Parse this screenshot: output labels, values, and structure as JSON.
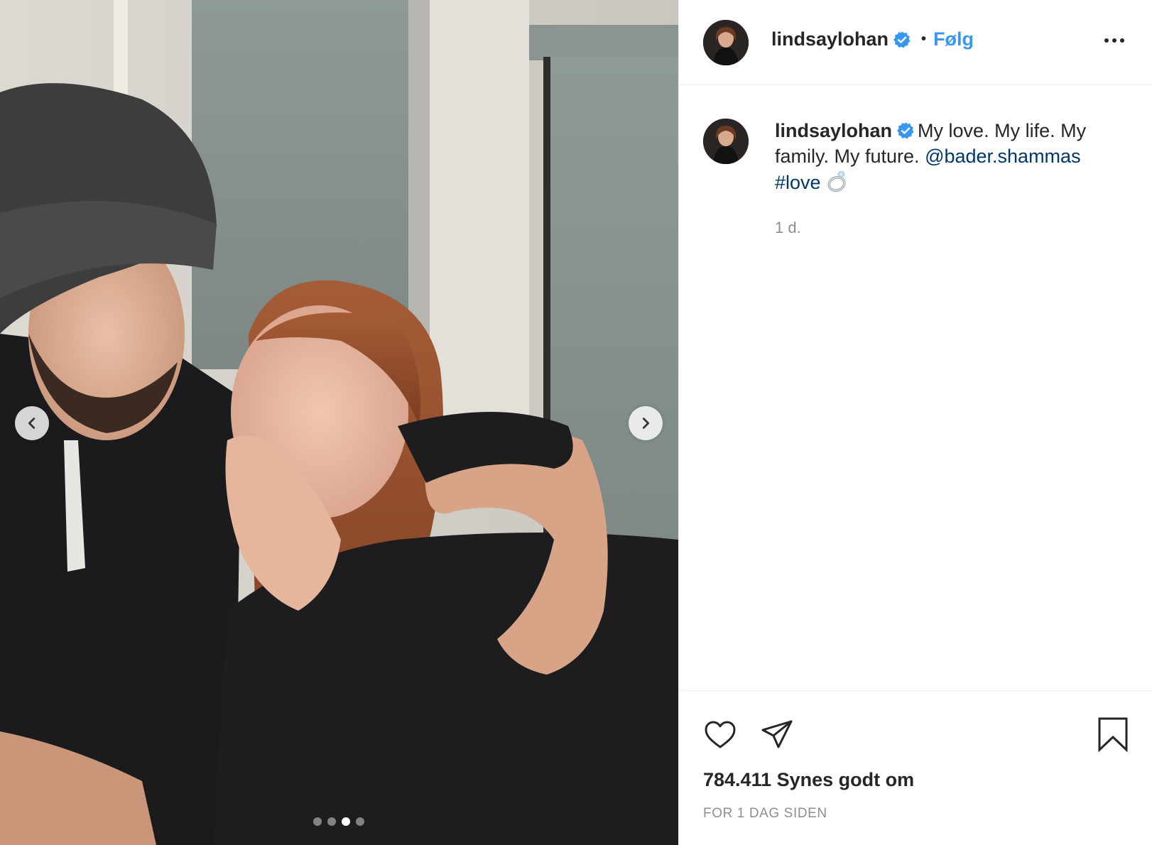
{
  "post": {
    "username": "lindsaylohan",
    "follow_label": "Følg",
    "separator": "•",
    "caption_text": "My love. My life. My family. My future.",
    "caption_mention": "@bader.shammas",
    "caption_hashtag": "#love",
    "comment_time": "1 d.",
    "likes": "784.411 Synes godt om",
    "posted_ago": "FOR 1 DAG SIDEN"
  },
  "carousel": {
    "total": 4,
    "active_index": 2
  },
  "icons": {
    "verified": "verified-badge-icon",
    "more": "more-options-icon",
    "like": "heart-icon",
    "share": "paper-plane-icon",
    "save": "bookmark-icon",
    "prev": "chevron-left-icon",
    "next": "chevron-right-icon",
    "ring": "ring-emoji-icon"
  },
  "colors": {
    "follow": "#3897f0",
    "link": "#00376b",
    "verified": "#3897f0",
    "muted": "#8e8e8e",
    "text": "#262626"
  }
}
